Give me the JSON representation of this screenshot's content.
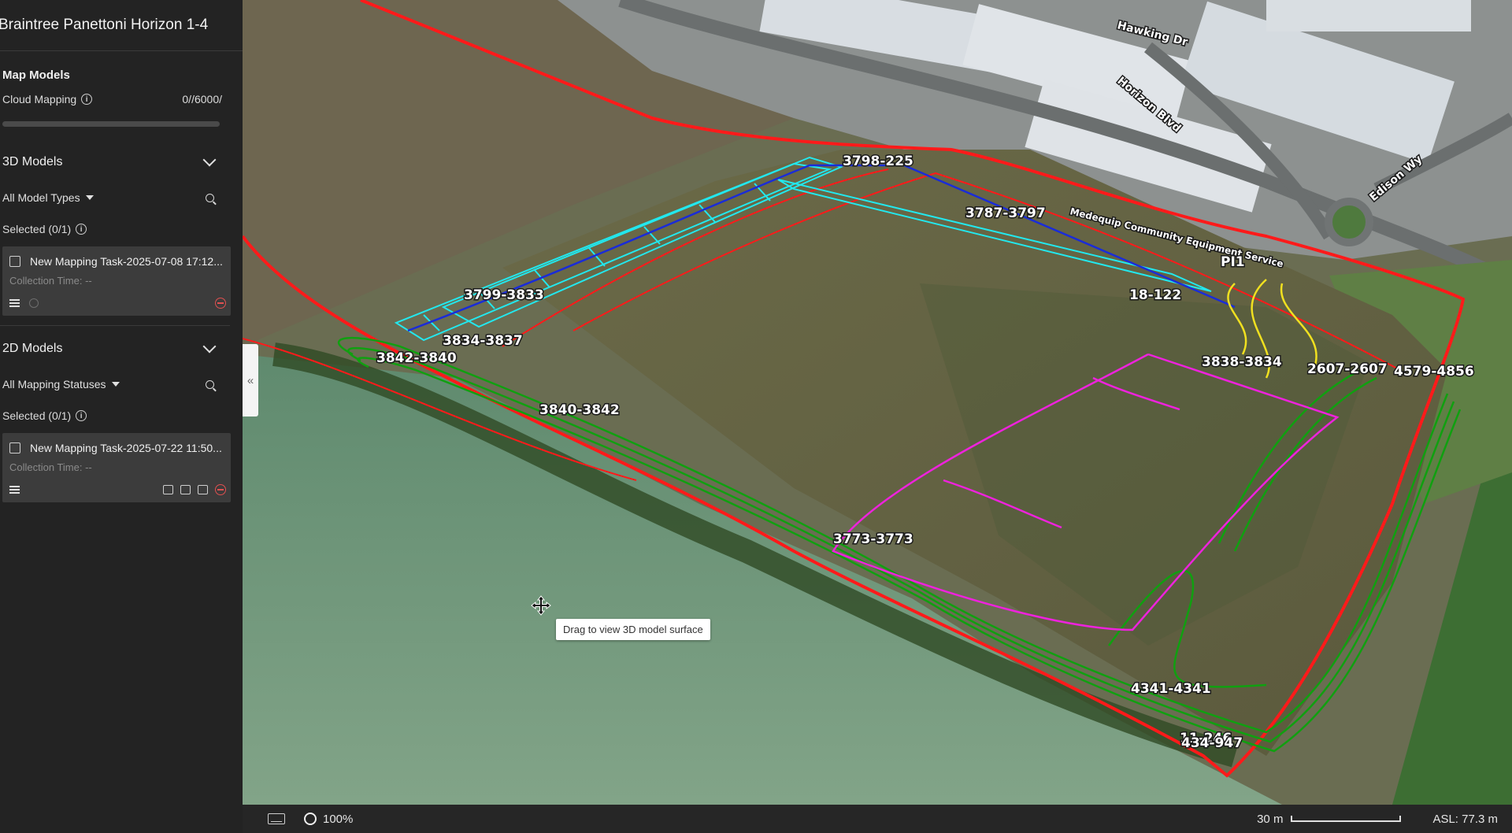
{
  "project": {
    "title": "Braintree Panettoni Horizon 1-4"
  },
  "map_models": {
    "heading": "Map Models",
    "cloud_mapping_label": "Cloud Mapping",
    "cloud_mapping_count": "0//6000/",
    "cloud_mapping_progress": 0
  },
  "models_3d": {
    "heading": "3D Models",
    "filter_label": "All Model Types",
    "selected_label": "Selected (0/1)",
    "task": {
      "title": "New Mapping Task-2025-07-08 17:12...",
      "collection_time": "Collection Time: --"
    }
  },
  "models_2d": {
    "heading": "2D Models",
    "filter_label": "All Mapping Statuses",
    "selected_label": "Selected (0/1)",
    "task": {
      "title": "New Mapping Task-2025-07-22 11:50...",
      "collection_time": "Collection Time: --"
    }
  },
  "map": {
    "tooltip": "Drag to view 3D model surface",
    "collapse_glyph": "«",
    "street_labels": [
      "Hawking Dr",
      "Horizon Blvd",
      "Edison Wy",
      "Medequip Community Equipment Service"
    ],
    "line_labels": [
      "3798-225",
      "3787-3797",
      "3799-3833",
      "18-122",
      "PI1",
      "3834-3837",
      "3842-3840",
      "3838-3834",
      "2607-2607",
      "4579-4856",
      "3840-3842",
      "3773-3773",
      "4341-4341",
      "11-246",
      "434-947"
    ]
  },
  "status_bar": {
    "zoom": "100%",
    "scale": "30 m",
    "asl": "ASL: 77.3 m"
  },
  "colors": {
    "boundary": "#ff2020",
    "cyan": "#22e8ee",
    "green": "#10a010",
    "magenta": "#ee22dd",
    "yellow": "#f0e020",
    "blue": "#1a2cd8"
  }
}
